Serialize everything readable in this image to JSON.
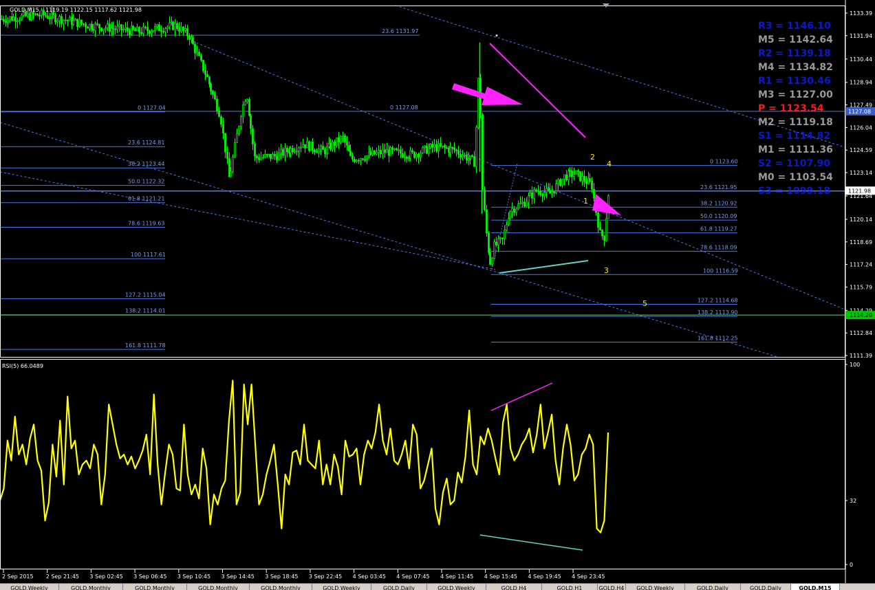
{
  "window": {
    "symbol_header": "GOLD,M15",
    "ohlc_header": "1119.19 1122.15 1117.62 1121.98",
    "rsi_header": "RSI(5) 66.0489"
  },
  "colors": {
    "background": "#000000",
    "candle": "#00ff00",
    "axis": "#ffffff",
    "fib_line": "#4a7ae8",
    "fib_label": "#7a9ef0",
    "channel": "#4a7ae8",
    "rsi": "#ffff00",
    "arrow": "#ff22ff",
    "divergence_low": "#5cd6c6",
    "price_tag_bg": "#00c800",
    "pivot_red": "#ff1a1a",
    "pivot_blue": "#0a1ac8",
    "pivot_gray": "#999999"
  },
  "chart_data": [
    {
      "type": "candlestick",
      "symbol": "GOLD",
      "timeframe": "M15",
      "ylim": [
        1111.39,
        1133.6
      ],
      "y_ticks": [
        "1133.39",
        "1131.94",
        "1130.44",
        "1128.94",
        "1127.49",
        "1126.04",
        "1124.59",
        "1123.14",
        "1121.64",
        "1120.14",
        "1118.69",
        "1117.24",
        "1115.79",
        "1114.29",
        "1112.84",
        "1111.39"
      ],
      "x_ticks": [
        "2 Sep 2015",
        "2 Sep 21:45",
        "3 Sep 02:45",
        "3 Sep 06:45",
        "3 Sep 10:45",
        "3 Sep 14:45",
        "3 Sep 18:45",
        "3 Sep 22:45",
        "4 Sep 03:45",
        "4 Sep 07:45",
        "4 Sep 11:45",
        "4 Sep 15:45",
        "4 Sep 19:45",
        "4 Sep 23:45"
      ],
      "price_path": [
        [
          0,
          1133.0
        ],
        [
          60,
          1133.3
        ],
        [
          130,
          1132.6
        ],
        [
          200,
          1132.2
        ],
        [
          255,
          1132.6
        ],
        [
          275,
          1131.9
        ],
        [
          300,
          1129.3
        ],
        [
          320,
          1126.8
        ],
        [
          333,
          1122.7
        ],
        [
          350,
          1127.0
        ],
        [
          358,
          1128.3
        ],
        [
          370,
          1124.1
        ],
        [
          400,
          1124.2
        ],
        [
          440,
          1125.0
        ],
        [
          470,
          1124.5
        ],
        [
          498,
          1125.4
        ],
        [
          510,
          1124.0
        ],
        [
          560,
          1124.5
        ],
        [
          600,
          1124.3
        ],
        [
          630,
          1124.8
        ],
        [
          660,
          1124.6
        ],
        [
          690,
          1123.8
        ],
        [
          697,
          1131.0
        ],
        [
          699,
          1123.0
        ],
        [
          706,
          1119.5
        ],
        [
          712,
          1117.3
        ],
        [
          718,
          1118.4
        ],
        [
          730,
          1118.8
        ],
        [
          740,
          1120.7
        ],
        [
          760,
          1121.2
        ],
        [
          780,
          1122.0
        ],
        [
          800,
          1121.8
        ],
        [
          820,
          1122.9
        ],
        [
          836,
          1123.1
        ],
        [
          850,
          1122.6
        ],
        [
          860,
          1122.4
        ],
        [
          866,
          1120.7
        ],
        [
          872,
          1119.2
        ],
        [
          878,
          1119.0
        ],
        [
          884,
          1121.98
        ]
      ],
      "last_price": "1121.98",
      "tagged_level": "1127.08",
      "bottom_line_label": "1114.20",
      "fibonacci": [
        {
          "label": "23.6 1131.97",
          "price": 1131.97
        },
        {
          "label": "0 1127.04",
          "price": 1127.04
        },
        {
          "label": "0 1127.08",
          "price": 1127.08
        },
        {
          "label": "23.6 1124.81",
          "price": 1124.81
        },
        {
          "label": "38.2 1123.44",
          "price": 1123.44
        },
        {
          "label": "50.0 1122.32",
          "price": 1122.32
        },
        {
          "label": "61.8 1121.21",
          "price": 1121.21
        },
        {
          "label": "78.6 1119.63",
          "price": 1119.63
        },
        {
          "label": "100 1117.61",
          "price": 1117.61
        },
        {
          "label": "127.2 1115.04",
          "price": 1115.04
        },
        {
          "label": "138.2 1114.01",
          "price": 1114.01
        },
        {
          "label": "161.8 1111.78",
          "price": 1111.78
        },
        {
          "label": "0 1123.60",
          "price": 1123.6
        },
        {
          "label": "23.6 1121.95",
          "price": 1121.95
        },
        {
          "label": "38.2 1120.92",
          "price": 1120.92
        },
        {
          "label": "50.0 1120.09",
          "price": 1120.09
        },
        {
          "label": "61.8 1119.27",
          "price": 1119.27
        },
        {
          "label": "78.6 1118.09",
          "price": 1118.09
        },
        {
          "label": "100 1116.59",
          "price": 1116.59
        },
        {
          "label": "127.2 1114.68",
          "price": 1114.68
        },
        {
          "label": "138.2 1113.90",
          "price": 1113.9
        },
        {
          "label": "161.8 1112.25",
          "price": 1112.25
        }
      ],
      "wave_labels": [
        "1",
        "2",
        "3",
        "4",
        "5"
      ],
      "pivots": [
        {
          "label": "R3 = 1146.10",
          "tone": "blue"
        },
        {
          "label": "M5 = 1142.64",
          "tone": "gray"
        },
        {
          "label": "R2 = 1139.18",
          "tone": "blue"
        },
        {
          "label": "M4 = 1134.82",
          "tone": "gray"
        },
        {
          "label": "R1 = 1130.46",
          "tone": "blue"
        },
        {
          "label": "M3 = 1127.00",
          "tone": "gray"
        },
        {
          "label": "P  = 1123.54",
          "tone": "red"
        },
        {
          "label": "M2 = 1119.18",
          "tone": "gray"
        },
        {
          "label": "S1 = 1114.82",
          "tone": "blue"
        },
        {
          "label": "M1 = 1111.36",
          "tone": "gray"
        },
        {
          "label": "S2 = 1107.90",
          "tone": "blue"
        },
        {
          "label": "M0 = 1103.54",
          "tone": "gray"
        },
        {
          "label": "S3 = 1099.18",
          "tone": "blue"
        }
      ]
    },
    {
      "type": "line",
      "title": "RSI(5) 66.0489",
      "ylim": [
        0,
        100
      ],
      "y_ticks": [
        "100",
        "32",
        "0"
      ],
      "series": [
        {
          "name": "RSI(5)",
          "values": [
            32,
            38,
            62,
            52,
            74,
            55,
            60,
            50,
            63,
            70,
            52,
            47,
            22,
            31,
            60,
            44,
            72,
            40,
            84,
            58,
            62,
            45,
            50,
            52,
            48,
            60,
            55,
            30,
            45,
            80,
            70,
            60,
            53,
            55,
            50,
            54,
            48,
            52,
            57,
            65,
            45,
            85,
            50,
            30,
            46,
            60,
            55,
            38,
            37,
            70,
            45,
            35,
            40,
            33,
            58,
            48,
            20,
            35,
            30,
            38,
            42,
            72,
            92,
            30,
            36,
            90,
            70,
            90,
            60,
            30,
            35,
            45,
            52,
            60,
            40,
            18,
            45,
            40,
            56,
            57,
            50,
            70,
            52,
            50,
            48,
            62,
            40,
            50,
            40,
            55,
            49,
            35,
            62,
            54,
            55,
            58,
            40,
            55,
            62,
            58,
            66,
            80,
            62,
            55,
            68,
            52,
            50,
            55,
            62,
            48,
            70,
            65,
            38,
            42,
            50,
            58,
            28,
            20,
            36,
            43,
            30,
            32,
            46,
            41,
            54,
            77,
            50,
            45,
            64,
            60,
            68,
            62,
            53,
            45,
            71,
            80,
            58,
            52,
            55,
            60,
            63,
            68,
            56,
            65,
            80,
            58,
            66,
            75,
            52,
            40,
            58,
            70,
            60,
            42,
            45,
            55,
            58,
            65,
            60,
            18,
            16,
            22,
            66
          ]
        }
      ]
    }
  ]
}
